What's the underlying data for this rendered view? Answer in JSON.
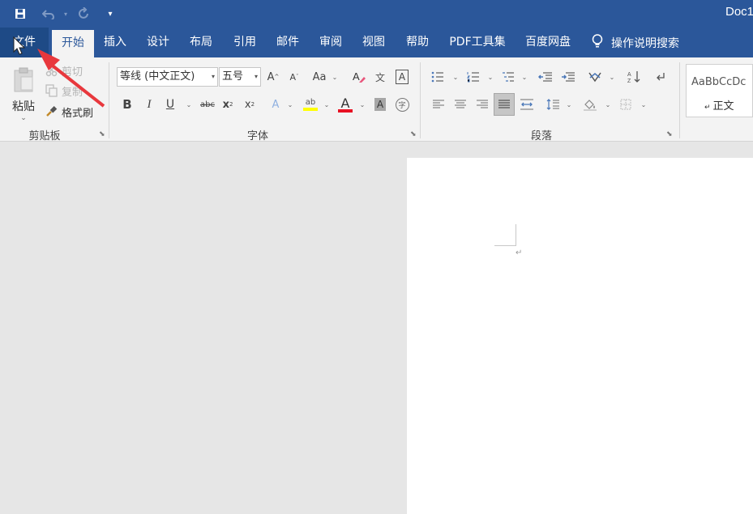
{
  "title_bar": {
    "doc_title": "Doc1",
    "qat_icons": [
      "save-icon",
      "undo-icon",
      "redo-icon",
      "customize-icon"
    ]
  },
  "tabs": [
    {
      "label": "文件",
      "state": "file"
    },
    {
      "label": "开始",
      "state": "active"
    },
    {
      "label": "插入"
    },
    {
      "label": "设计"
    },
    {
      "label": "布局"
    },
    {
      "label": "引用"
    },
    {
      "label": "邮件"
    },
    {
      "label": "审阅"
    },
    {
      "label": "视图"
    },
    {
      "label": "帮助"
    },
    {
      "label": "PDF工具集"
    },
    {
      "label": "百度网盘"
    }
  ],
  "tell_me": {
    "label": "操作说明搜索",
    "icon": "lightbulb-icon"
  },
  "clipboard": {
    "paste_label": "粘贴",
    "cut_label": "剪切",
    "copy_label": "复制",
    "format_painter_label": "格式刷",
    "group_label": "剪贴板"
  },
  "font": {
    "font_name": "等线 (中文正文)",
    "font_size": "五号",
    "grow_label": "A",
    "shrink_label": "A",
    "change_case_label": "Aa",
    "phonetic_label": "文",
    "border_char_label": "A",
    "bold_label": "B",
    "italic_label": "I",
    "underline_label": "U",
    "strike_label": "abc",
    "subscript_label": "x",
    "superscript_label": "x",
    "text_effects_label": "A",
    "highlight_label": "ab",
    "font_color_label": "A",
    "char_shading_label": "A",
    "enclose_label": "字",
    "group_label": "字体",
    "colors": {
      "font_color": "#e81123",
      "highlight": "#ffff00"
    }
  },
  "paragraph": {
    "group_label": "段落"
  },
  "styles": {
    "sample_text": "AaBbCcDc",
    "style_name": "正文",
    "paragraph_mark": "↵"
  },
  "document": {
    "paragraph_mark": "↵"
  },
  "colors": {
    "accent": "#2b579a",
    "arrow": "#e8383d"
  }
}
